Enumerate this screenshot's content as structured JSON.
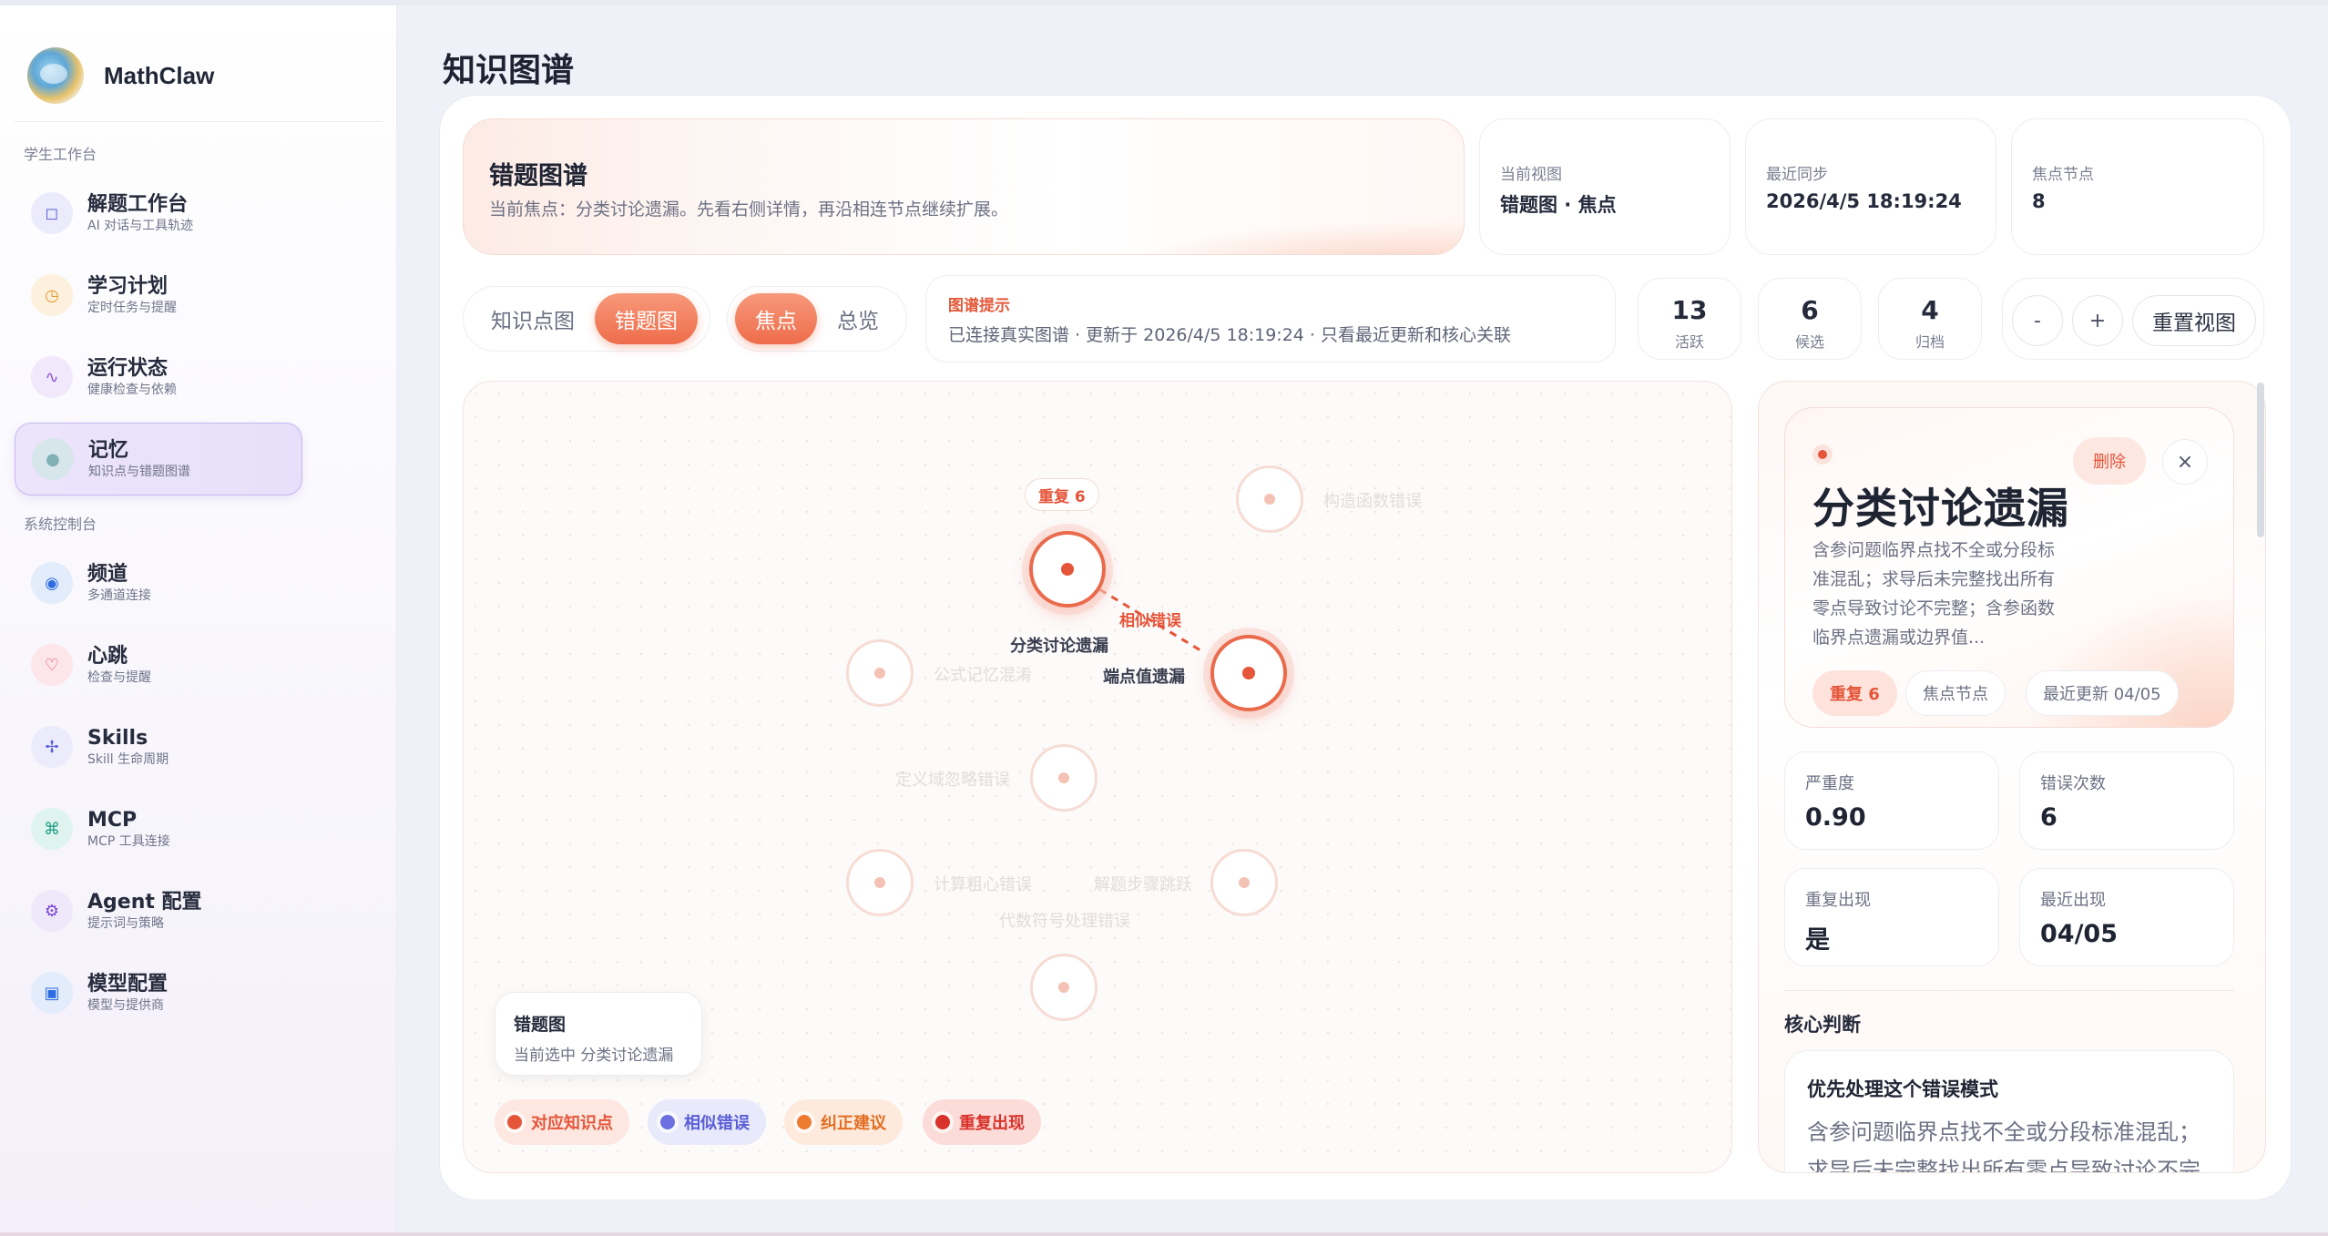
{
  "brand": {
    "name": "MathClaw"
  },
  "sidebar": {
    "section_student": "学生工作台",
    "section_system": "系统控制台",
    "items": [
      {
        "title": "解题工作台",
        "sub": "AI 对话与工具轨迹",
        "icon": "◻"
      },
      {
        "title": "学习计划",
        "sub": "定时任务与提醒",
        "icon": "◷"
      },
      {
        "title": "运行状态",
        "sub": "健康检查与依赖",
        "icon": "∿"
      },
      {
        "title": "记忆",
        "sub": "知识点与错题图谱",
        "icon": "●"
      },
      {
        "title": "频道",
        "sub": "多通道连接",
        "icon": "◉"
      },
      {
        "title": "心跳",
        "sub": "检查与提醒",
        "icon": "♡"
      },
      {
        "title": "Skills",
        "sub": "Skill 生命周期",
        "icon": "✢"
      },
      {
        "title": "MCP",
        "sub": "MCP 工具连接",
        "icon": "⌘"
      },
      {
        "title": "Agent 配置",
        "sub": "提示词与策略",
        "icon": "⚙"
      },
      {
        "title": "模型配置",
        "sub": "模型与提供商",
        "icon": "▣"
      }
    ]
  },
  "page": {
    "title": "知识图谱"
  },
  "hero": {
    "title": "错题图谱",
    "subtitle": "当前焦点：分类讨论遗漏。先看右侧详情，再沿相连节点继续扩展。"
  },
  "stats": [
    {
      "label": "当前视图",
      "value": "错题图 · 焦点"
    },
    {
      "label": "最近同步",
      "value": "2026/4/5 18:19:24"
    },
    {
      "label": "焦点节点",
      "value": "8"
    }
  ],
  "toolbar": {
    "view_tabs": [
      "知识点图",
      "错题图"
    ],
    "mode_tabs": [
      "焦点",
      "总览"
    ],
    "hint_title": "图谱提示",
    "hint_text": "已连接真实图谱 · 更新于 2026/4/5 18:19:24 · 只看最近更新和核心关联",
    "counts": [
      {
        "num": "13",
        "label": "活跃"
      },
      {
        "num": "6",
        "label": "候选"
      },
      {
        "num": "4",
        "label": "归档"
      }
    ],
    "zoom_out": "-",
    "zoom_in": "+",
    "reset": "重置视图"
  },
  "graph": {
    "focus_badge": "重复 6",
    "edge_label": "相似错误",
    "nodes": [
      "分类讨论遗漏",
      "端点值遗漏",
      "构造函数错误",
      "公式记忆混淆",
      "定义域忽略错误",
      "计算粗心错误",
      "解题步骤跳跃",
      "代数符号处理错误",
      ""
    ],
    "legend_title": "错题图",
    "legend_sub": "当前选中 分类讨论遗漏",
    "chips": [
      {
        "label": "对应知识点",
        "color": "#e5553a"
      },
      {
        "label": "相似错误",
        "color": "#6b6fe0"
      },
      {
        "label": "纠正建议",
        "color": "#ee7a2f"
      },
      {
        "label": "重复出现",
        "color": "#d9322b"
      }
    ]
  },
  "detail": {
    "title": "分类讨论遗漏",
    "desc": "含参问题临界点找不全或分段标准混乱；求导后未完整找出所有零点导致讨论不完整；含参函数临界点遗漏或边界值...",
    "delete": "删除",
    "close": "×",
    "tags": [
      "重复 6",
      "焦点节点",
      "最近更新 04/05"
    ],
    "metrics": [
      {
        "label": "严重度",
        "value": "0.90"
      },
      {
        "label": "错误次数",
        "value": "6"
      },
      {
        "label": "重复出现",
        "value": "是"
      },
      {
        "label": "最近出现",
        "value": "04/05"
      }
    ],
    "section": "核心判断",
    "judge_title": "优先处理这个错误模式",
    "judge_text": "含参问题临界点找不全或分段标准混乱；求导后未完整找出所有零点导致讨论不完整"
  }
}
